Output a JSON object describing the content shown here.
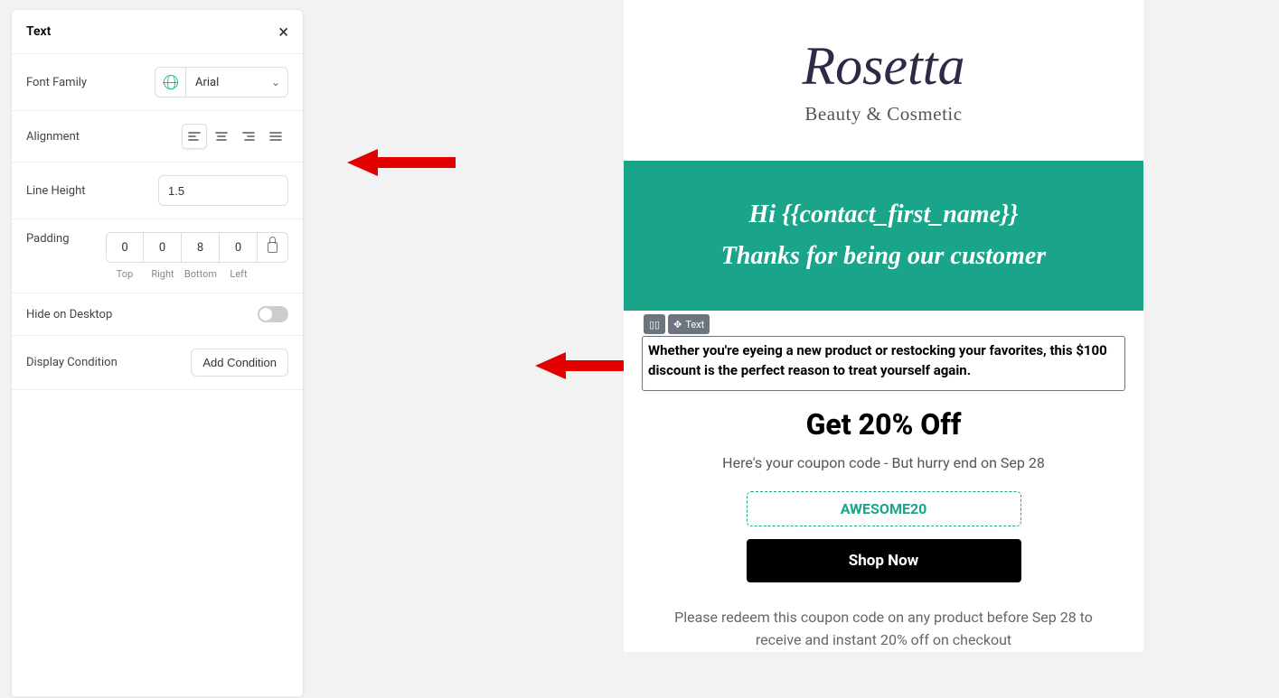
{
  "sidebar": {
    "title": "Text",
    "fontFamily": {
      "label": "Font Family",
      "value": "Arial"
    },
    "alignment": {
      "label": "Alignment"
    },
    "lineHeight": {
      "label": "Line Height",
      "value": "1.5"
    },
    "padding": {
      "label": "Padding",
      "top": {
        "value": "0",
        "label": "Top"
      },
      "right": {
        "value": "0",
        "label": "Right"
      },
      "bottom": {
        "value": "8",
        "label": "Bottom"
      },
      "left": {
        "value": "0",
        "label": "Left"
      }
    },
    "hideOnDesktop": {
      "label": "Hide on Desktop"
    },
    "displayCondition": {
      "label": "Display Condition",
      "button": "Add Condition"
    }
  },
  "handles": {
    "text": "Text"
  },
  "email": {
    "logo": "Rosetta",
    "logoSub": "Beauty & Cosmetic",
    "greet1": "Hi {{contact_first_name}}",
    "greet2": "Thanks for being our customer",
    "textBlock": "Whether you're eyeing a new product or restocking your favorites, this $100 discount is the perfect reason to treat yourself again.",
    "getOff": "Get 20% Off",
    "couponSub": "Here's your coupon code - But hurry end on Sep 28",
    "couponCode": "AWESOME20",
    "shopBtn": "Shop Now",
    "redeem": "Please redeem this coupon code on any product before Sep 28 to receive and instant 20% off on checkout"
  }
}
